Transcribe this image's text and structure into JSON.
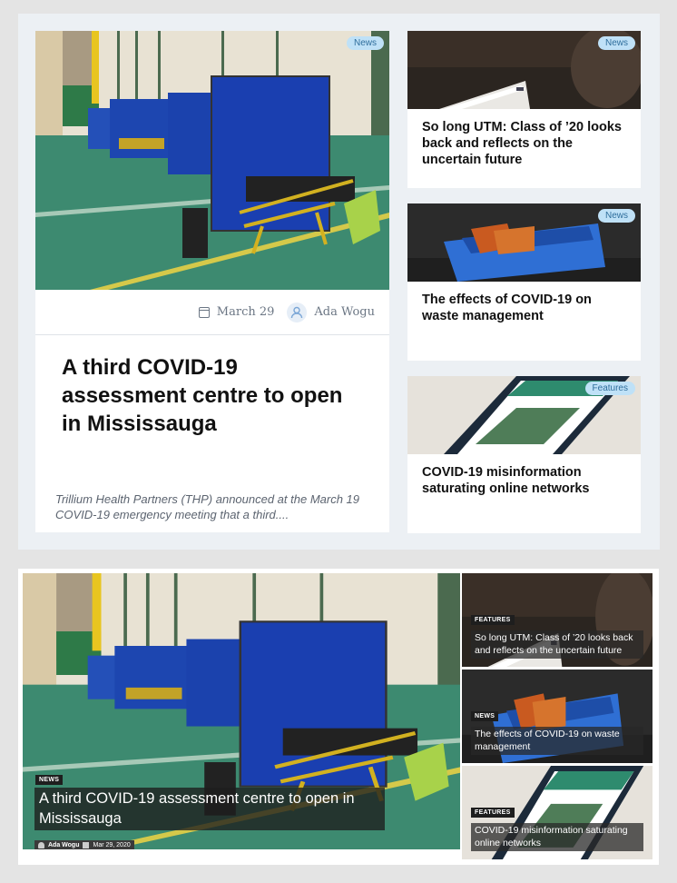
{
  "layout1": {
    "featured": {
      "tag": "News",
      "date": "March 29",
      "author": "Ada Wogu",
      "title": "A third COVID-19 assessment centre to open in Mississauga",
      "excerpt": "Trillium Health Partners (THP) announced at the March 19 COVID-19 emergency meeting that a third...."
    },
    "side": [
      {
        "tag": "News",
        "title": "So long UTM: Class of ’20 looks back and reflects on the uncertain future"
      },
      {
        "tag": "News",
        "title": "The effects of COVID-19 on waste management"
      },
      {
        "tag": "Features",
        "title": "COVID-19 misinformation saturating online networks"
      }
    ]
  },
  "layout2": {
    "featured": {
      "tag": "NEWS",
      "title": "A third COVID-19 assessment centre to open in Mississauga",
      "author": "Ada Wogu",
      "date": "Mar 29, 2020"
    },
    "side": [
      {
        "tag": "FEATURES",
        "title": "So long UTM: Class of ’20 looks back and reflects on the uncertain future"
      },
      {
        "tag": "NEWS",
        "title": "The effects of COVID-19 on waste management"
      },
      {
        "tag": "FEATURES",
        "title": "COVID-19 misinformation saturating online networks"
      }
    ]
  },
  "colors": {
    "pill_bg": "#bfe1f7",
    "pill_text": "#2f6e9c",
    "panel_bg": "#ecf0f4"
  }
}
